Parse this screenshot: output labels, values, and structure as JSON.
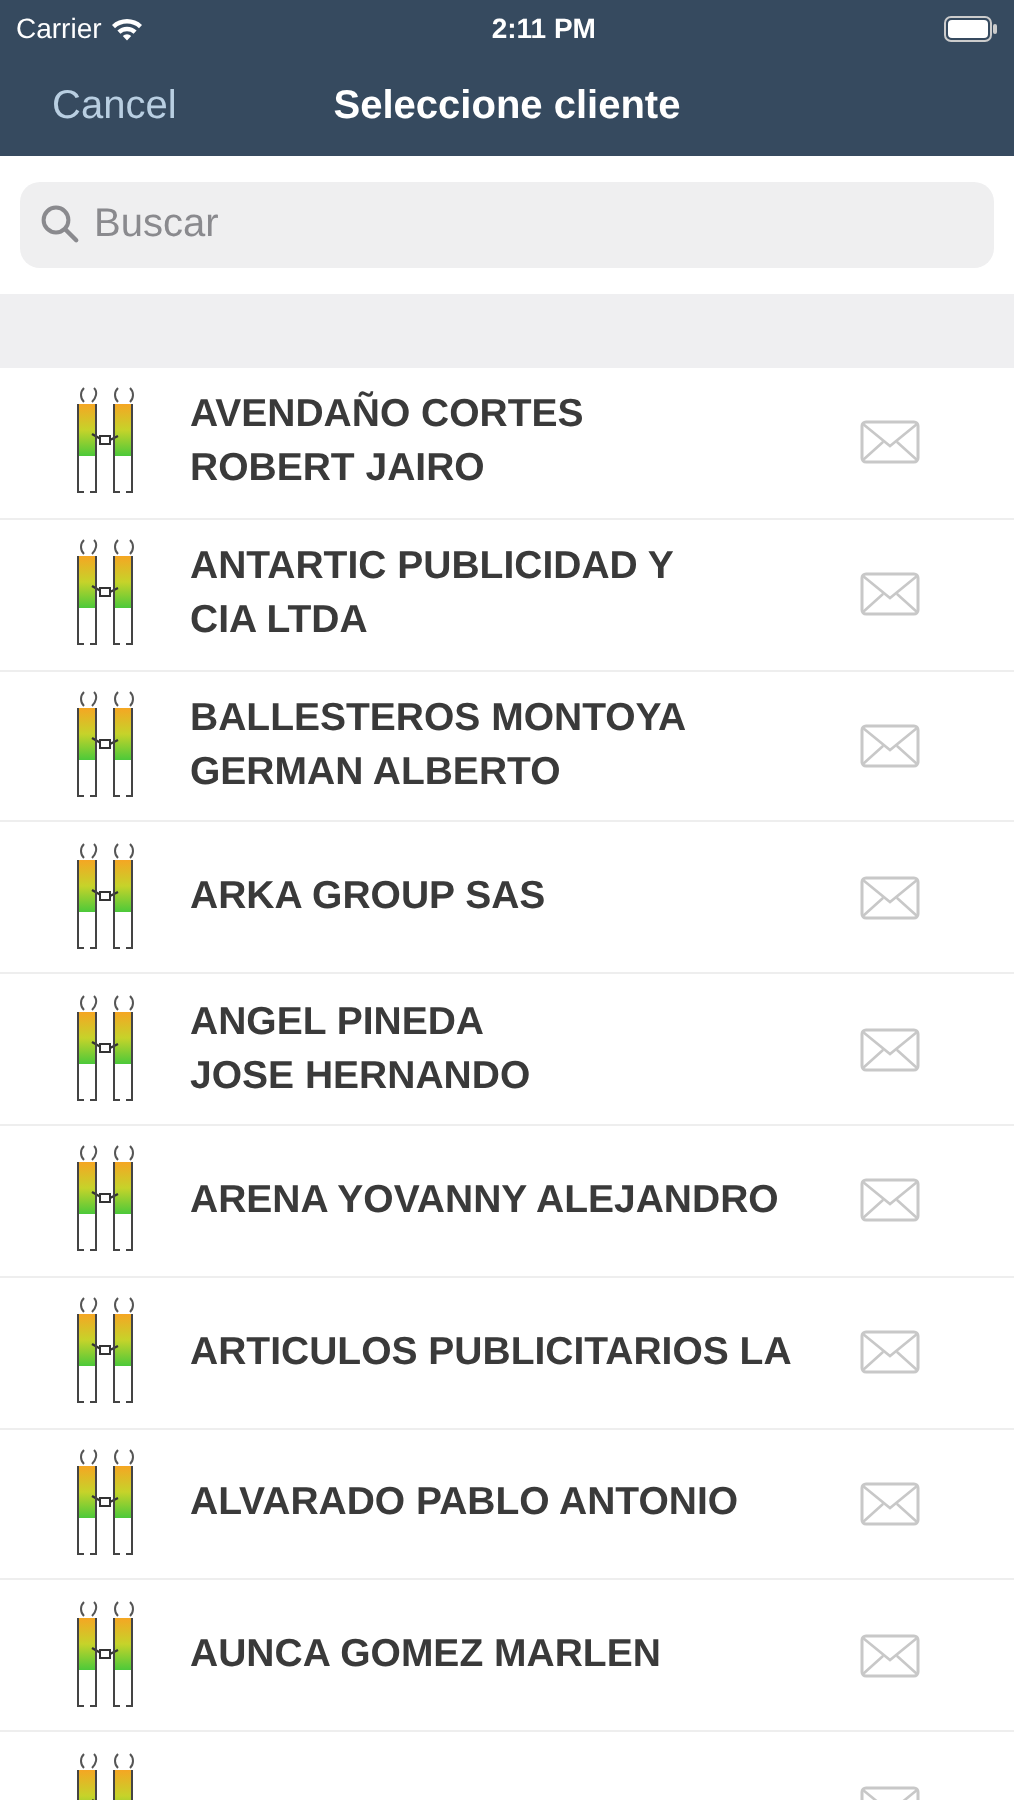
{
  "status_bar": {
    "carrier": "Carrier",
    "time": "2:11 PM"
  },
  "nav": {
    "cancel": "Cancel",
    "title": "Seleccione cliente"
  },
  "search": {
    "placeholder": "Buscar"
  },
  "clients": [
    {
      "kind": "full",
      "lines": [
        "AVENDAÑO CORTES",
        "ROBERT JAIRO"
      ]
    },
    {
      "kind": "full",
      "lines": [
        "ANTARTIC PUBLICIDAD Y",
        "CIA LTDA"
      ]
    },
    {
      "kind": "full",
      "lines": [
        "BALLESTEROS MONTOYA",
        "GERMAN ALBERTO"
      ]
    },
    {
      "kind": "full",
      "lines": [
        "ARKA GROUP SAS"
      ]
    },
    {
      "kind": "full",
      "lines": [
        "ANGEL PINEDA",
        "JOSE HERNANDO"
      ]
    },
    {
      "kind": "full",
      "lines": [
        "ARENA YOVANNY ALEJANDRO"
      ]
    },
    {
      "kind": "full",
      "lines": [
        "ARTICULOS PUBLICITARIOS LA"
      ]
    },
    {
      "kind": "full",
      "lines": [
        "ALVARADO PABLO ANTONIO"
      ]
    },
    {
      "kind": "full",
      "lines": [
        "AUNCA GOMEZ MARLEN"
      ]
    },
    {
      "kind": "cut"
    }
  ]
}
